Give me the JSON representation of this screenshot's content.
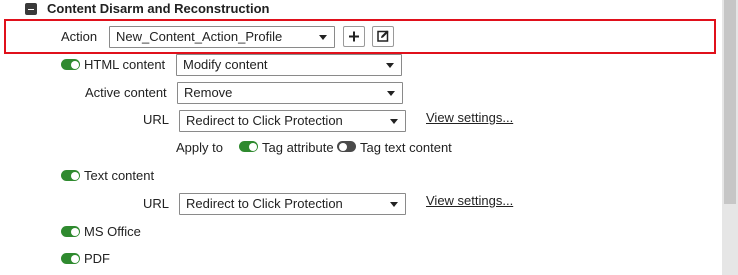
{
  "section": {
    "title": "Content Disarm and Reconstruction"
  },
  "action": {
    "label": "Action",
    "value": "New_Content_Action_Profile"
  },
  "html_content": {
    "label": "HTML content",
    "enabled": true,
    "value": "Modify content"
  },
  "active_content": {
    "label": "Active content",
    "value": "Remove"
  },
  "url1": {
    "label": "URL",
    "value": "Redirect to Click Protection",
    "link": "View settings..."
  },
  "apply_to": {
    "label": "Apply to",
    "tag_attribute": {
      "label": "Tag attribute",
      "enabled": true
    },
    "tag_text_content": {
      "label": "Tag text content",
      "enabled": false
    }
  },
  "text_content": {
    "label": "Text content",
    "enabled": true
  },
  "url2": {
    "label": "URL",
    "value": "Redirect to Click Protection",
    "link": "View settings..."
  },
  "ms_office": {
    "label": "MS Office",
    "enabled": true
  },
  "pdf": {
    "label": "PDF",
    "enabled": true
  },
  "icons": {
    "collapse": "minus-square-icon",
    "add": "plus-icon",
    "edit": "edit-icon"
  },
  "colors": {
    "highlight": "#e0101b",
    "toggle_on": "#2f8a2f",
    "toggle_off": "#4a4a4a"
  }
}
